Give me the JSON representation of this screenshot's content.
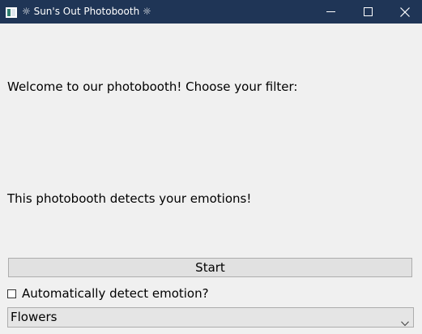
{
  "window": {
    "title": "☼ Sun's Out Photobooth ☼",
    "titlebar_color": "#1f3556"
  },
  "main": {
    "welcome_text": "Welcome to our photobooth! Choose your filter:",
    "emotion_text": "This photobooth detects your emotions!",
    "start_label": "Start",
    "auto_detect_label": "Automatically detect emotion?",
    "auto_detect_checked": false,
    "filter_selected": "Flowers"
  }
}
